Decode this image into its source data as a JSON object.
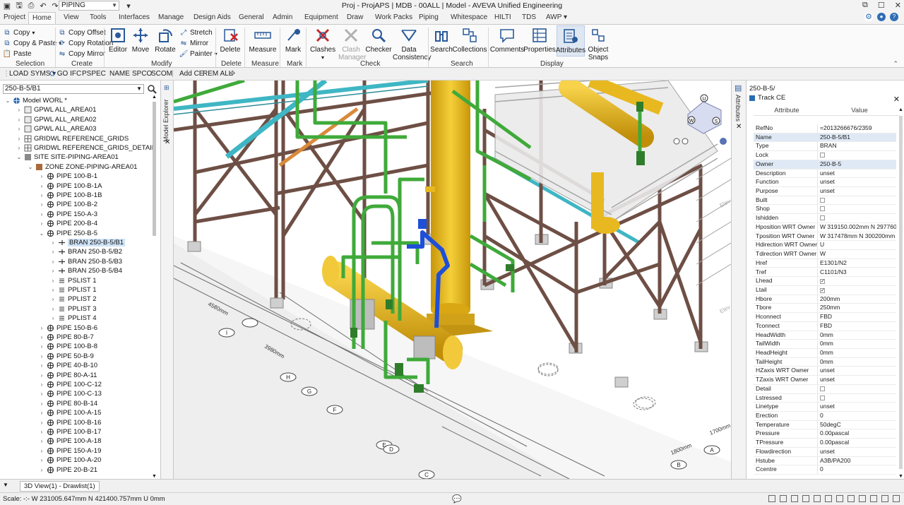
{
  "app": {
    "module": "PIPING",
    "title": "Proj - ProjAPS | MDB - 00ALL | Model - AVEVA Unified Engineering"
  },
  "tabs": [
    "Project",
    "Home",
    "View",
    "Tools",
    "Interfaces",
    "Manage",
    "Design Aids",
    "General",
    "Admin",
    "Equipment",
    "Draw",
    "Work Packs",
    "Piping",
    "Whitespace",
    "HILTI",
    "TDS",
    "AWP"
  ],
  "active_tab": "Home",
  "ribbon": {
    "selection": {
      "copy": "Copy",
      "copy_paste": "Copy & Paste",
      "paste": "Paste",
      "label": "Selection"
    },
    "create": {
      "copy_offset": "Copy Offset",
      "copy_rotation": "Copy Rotation",
      "copy_mirror": "Copy Mirror",
      "label": "Create"
    },
    "modify": {
      "editor": "Editor",
      "move": "Move",
      "rotate": "Rotate",
      "stretch": "Stretch",
      "mirror": "Mirror",
      "painter": "Painter",
      "label": "Modify"
    },
    "delete": {
      "btn": "Delete",
      "label": "Delete"
    },
    "measure": {
      "btn": "Measure",
      "label": "Measure"
    },
    "mark": {
      "btn": "Mark",
      "label": "Mark"
    },
    "check": {
      "clashes": "Clashes",
      "clash_manager": "Clash Manager",
      "checker": "Checker",
      "data_consistency": "Data Consistency",
      "label": "Check"
    },
    "search": {
      "search": "Search",
      "collections": "Collections",
      "label": "Search"
    },
    "display": {
      "comments": "Comments",
      "properties": "Properties",
      "attributes": "Attributes",
      "object_snaps": "Object Snaps",
      "label": "Display"
    }
  },
  "toolbar": [
    "LOAD SYMS",
    "GO IFC",
    "PSPEC",
    "NAME",
    "SPCO",
    "SCOM",
    "Add CE",
    "REM ALL"
  ],
  "explorer": {
    "search_value": "250-B-5/B1",
    "strip_label": "Model Explorer",
    "tree": [
      {
        "label": "Model WORL *",
        "level": 0,
        "exp": "v",
        "icon": "world"
      },
      {
        "label": "GPWL ALL_AREA01",
        "level": 1,
        "exp": ">",
        "icon": "group"
      },
      {
        "label": "GPWL ALL_AREA02",
        "level": 1,
        "exp": ">",
        "icon": "group"
      },
      {
        "label": "GPWL ALL_AREA03",
        "level": 1,
        "exp": ">",
        "icon": "group"
      },
      {
        "label": "GRIDWL REFERENCE_GRIDS",
        "level": 1,
        "exp": ">",
        "icon": "grid"
      },
      {
        "label": "GRIDWL REFERENCE_GRIDS_DETAIL",
        "level": 1,
        "exp": ">",
        "icon": "grid"
      },
      {
        "label": "SITE SITE-PIPING-AREA01",
        "level": 1,
        "exp": "v",
        "icon": "site"
      },
      {
        "label": "ZONE ZONE-PIPING-AREA01",
        "level": 2,
        "exp": "v",
        "icon": "zone"
      },
      {
        "label": "PIPE 100-B-1",
        "level": 3,
        "exp": ">",
        "icon": "pipe"
      },
      {
        "label": "PIPE 100-B-1A",
        "level": 3,
        "exp": ">",
        "icon": "pipe"
      },
      {
        "label": "PIPE 100-B-1B",
        "level": 3,
        "exp": ">",
        "icon": "pipe"
      },
      {
        "label": "PIPE 100-B-2",
        "level": 3,
        "exp": ">",
        "icon": "pipe"
      },
      {
        "label": "PIPE 150-A-3",
        "level": 3,
        "exp": ">",
        "icon": "pipe"
      },
      {
        "label": "PIPE 200-B-4",
        "level": 3,
        "exp": ">",
        "icon": "pipe"
      },
      {
        "label": "PIPE 250-B-5",
        "level": 3,
        "exp": "v",
        "icon": "pipe"
      },
      {
        "label": "BRAN 250-B-5/B1",
        "level": 4,
        "exp": ">",
        "icon": "bran",
        "selected": true
      },
      {
        "label": "BRAN 250-B-5/B2",
        "level": 4,
        "exp": ">",
        "icon": "bran"
      },
      {
        "label": "BRAN 250-B-5/B3",
        "level": 4,
        "exp": ">",
        "icon": "bran"
      },
      {
        "label": "BRAN 250-B-5/B4",
        "level": 4,
        "exp": ">",
        "icon": "bran"
      },
      {
        "label": "PSLIST 1",
        "level": 4,
        "exp": ">",
        "icon": "list"
      },
      {
        "label": "PPLIST 1",
        "level": 4,
        "exp": ">",
        "icon": "list"
      },
      {
        "label": "PPLIST 2",
        "level": 4,
        "exp": ">",
        "icon": "list"
      },
      {
        "label": "PPLIST 3",
        "level": 4,
        "exp": ">",
        "icon": "list"
      },
      {
        "label": "PPLIST 4",
        "level": 4,
        "exp": ">",
        "icon": "list"
      },
      {
        "label": "PIPE 150-B-6",
        "level": 3,
        "exp": ">",
        "icon": "pipe"
      },
      {
        "label": "PIPE 80-B-7",
        "level": 3,
        "exp": ">",
        "icon": "pipe"
      },
      {
        "label": "PIPE 100-B-8",
        "level": 3,
        "exp": ">",
        "icon": "pipe"
      },
      {
        "label": "PIPE 50-B-9",
        "level": 3,
        "exp": ">",
        "icon": "pipe"
      },
      {
        "label": "PIPE 40-B-10",
        "level": 3,
        "exp": ">",
        "icon": "pipe"
      },
      {
        "label": "PIPE 80-A-11",
        "level": 3,
        "exp": ">",
        "icon": "pipe"
      },
      {
        "label": "PIPE 100-C-12",
        "level": 3,
        "exp": ">",
        "icon": "pipe"
      },
      {
        "label": "PIPE 100-C-13",
        "level": 3,
        "exp": ">",
        "icon": "pipe"
      },
      {
        "label": "PIPE 80-B-14",
        "level": 3,
        "exp": ">",
        "icon": "pipe"
      },
      {
        "label": "PIPE 100-A-15",
        "level": 3,
        "exp": ">",
        "icon": "pipe"
      },
      {
        "label": "PIPE 100-B-16",
        "level": 3,
        "exp": ">",
        "icon": "pipe"
      },
      {
        "label": "PIPE 100-B-17",
        "level": 3,
        "exp": ">",
        "icon": "pipe"
      },
      {
        "label": "PIPE 100-A-18",
        "level": 3,
        "exp": ">",
        "icon": "pipe"
      },
      {
        "label": "PIPE 150-A-19",
        "level": 3,
        "exp": ">",
        "icon": "pipe"
      },
      {
        "label": "PIPE 100-A-20",
        "level": 3,
        "exp": ">",
        "icon": "pipe"
      },
      {
        "label": "PIPE 20-B-21",
        "level": 3,
        "exp": ">",
        "icon": "pipe"
      }
    ]
  },
  "viewport": {
    "grid_labels": [
      "I",
      "H",
      "G",
      "F",
      "E",
      "D",
      "C",
      "A",
      "B"
    ],
    "dims": [
      "4580mm",
      "3980mm",
      "1800mm",
      "1700mm"
    ],
    "nav_labels": [
      "U",
      "W",
      "S"
    ]
  },
  "attributes": {
    "ce": "250-B-5/",
    "track_ce": "Track CE",
    "strip_label": "Attributes",
    "col_attribute": "Attribute",
    "col_value": "Value",
    "rows": [
      {
        "k": "RefNo",
        "v": "=2013266676/2359"
      },
      {
        "k": "Name",
        "v": "250-B-5/B1",
        "sel": true
      },
      {
        "k": "Type",
        "v": "BRAN"
      },
      {
        "k": "Lock",
        "cb": "off"
      },
      {
        "k": "Owner",
        "v": "250-B-5",
        "sel": true
      },
      {
        "k": "Description",
        "v": "unset"
      },
      {
        "k": "Function",
        "v": "unset"
      },
      {
        "k": "Purpose",
        "v": "unset"
      },
      {
        "k": "Built",
        "cb": "off"
      },
      {
        "k": "Shop",
        "cb": "off"
      },
      {
        "k": "Ishidden",
        "cb": "off"
      },
      {
        "k": "Hposition WRT Owner",
        "v": "W 319150.002mm N 297760..."
      },
      {
        "k": "Tposition WRT Owner",
        "v": "W 317478mm N 300200mm U..."
      },
      {
        "k": "Hdirection WRT Owner",
        "v": "U"
      },
      {
        "k": "Tdirection WRT Owner",
        "v": "W"
      },
      {
        "k": "Href",
        "v": "E1301/N2"
      },
      {
        "k": "Tref",
        "v": "C1101/N3"
      },
      {
        "k": "Lhead",
        "cb": "on"
      },
      {
        "k": "Ltail",
        "cb": "on"
      },
      {
        "k": "Hbore",
        "v": "200mm"
      },
      {
        "k": "Tbore",
        "v": "250mm"
      },
      {
        "k": "Hconnect",
        "v": "FBD"
      },
      {
        "k": "Tconnect",
        "v": "FBD"
      },
      {
        "k": "HeadWidth",
        "v": "0mm"
      },
      {
        "k": "TailWidth",
        "v": "0mm"
      },
      {
        "k": "HeadHeight",
        "v": "0mm"
      },
      {
        "k": "TailHeight",
        "v": "0mm"
      },
      {
        "k": "HZaxis WRT Owner",
        "v": "unset"
      },
      {
        "k": "TZaxis WRT Owner",
        "v": "unset"
      },
      {
        "k": "Detail",
        "cb": "off"
      },
      {
        "k": "Lstressed",
        "cb": "off"
      },
      {
        "k": "Linetype",
        "v": "unset"
      },
      {
        "k": "Erection",
        "v": "0"
      },
      {
        "k": "Temperature",
        "v": "50degC"
      },
      {
        "k": "Pressure",
        "v": "0.00pascal"
      },
      {
        "k": "TPressure",
        "v": "0.00pascal"
      },
      {
        "k": "Flowdirection",
        "v": "unset"
      },
      {
        "k": "Hstube",
        "v": "A3B/PA200"
      },
      {
        "k": "Ccentre",
        "v": "0"
      }
    ]
  },
  "bottom": {
    "view_tab": "3D View(1) - Drawlist(1)",
    "status": "Scale: -:- W 231005.647mm N 421400.757mm U 0mm"
  },
  "colors": {
    "steel": "#7a5a4e",
    "pipe_green": "#3faa3a",
    "vessel_yellow": "#e8b820",
    "highlight_blue": "#1e4fd8",
    "cable_tray": "#3fb6c4",
    "accent": "#2f6db5"
  }
}
